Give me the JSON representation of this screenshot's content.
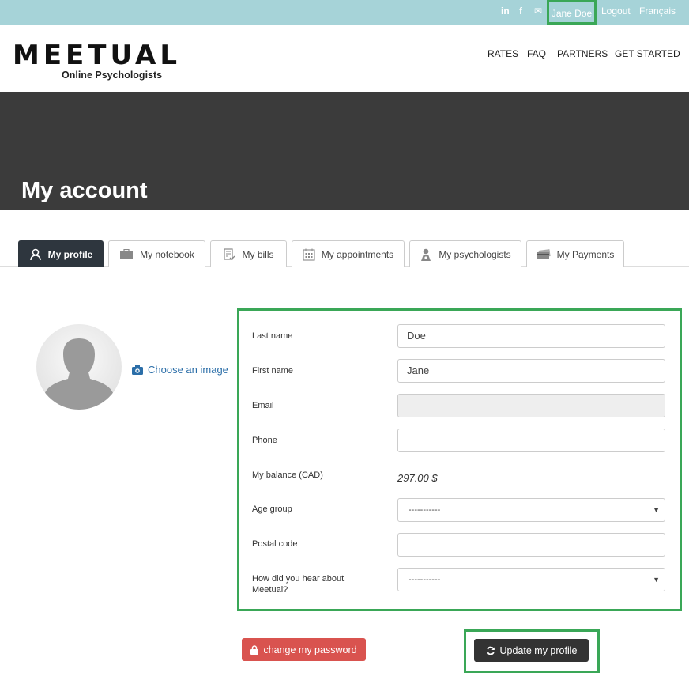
{
  "topbar": {
    "social": {
      "linkedin": "in",
      "facebook": "f",
      "email": "✉"
    },
    "user_name": "Jane Doe",
    "logout": "Logout",
    "language": "Français"
  },
  "header": {
    "logo": "MEETUAL",
    "logo_subtitle": "Online Psychologists",
    "nav": [
      "RATES",
      "FAQ",
      "PARTNERS",
      "GET STARTED"
    ]
  },
  "hero": {
    "title": "My account"
  },
  "tabs": [
    {
      "label": "My profile",
      "icon": "user-icon",
      "active": true
    },
    {
      "label": "My notebook",
      "icon": "briefcase-icon"
    },
    {
      "label": "My bills",
      "icon": "bill-icon"
    },
    {
      "label": "My appointments",
      "icon": "calendar-icon"
    },
    {
      "label": "My psychologists",
      "icon": "psychologist-icon"
    },
    {
      "label": "My Payments",
      "icon": "card-icon"
    }
  ],
  "profile": {
    "choose_image": "Choose an image"
  },
  "form": {
    "last_name": {
      "label": "Last name",
      "value": "Doe"
    },
    "first_name": {
      "label": "First name",
      "value": "Jane"
    },
    "email": {
      "label": "Email",
      "value": ""
    },
    "phone": {
      "label": "Phone",
      "value": ""
    },
    "balance": {
      "label": "My balance (CAD)",
      "value": "297.00 $"
    },
    "age_group": {
      "label": "Age group",
      "selected": "-----------"
    },
    "postal_code": {
      "label": "Postal code",
      "value": ""
    },
    "heard_about": {
      "label": "How did you hear about Meetual?",
      "selected": "-----------"
    }
  },
  "buttons": {
    "change_password": "change my password",
    "update_profile": "Update my profile"
  },
  "colors": {
    "accent_green": "#3aa757",
    "topbar": "#a6d3d8",
    "danger": "#d9534f",
    "dark": "#333333"
  }
}
